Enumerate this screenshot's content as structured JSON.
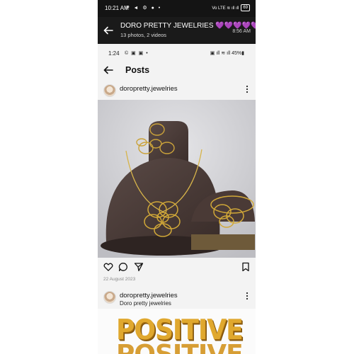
{
  "outer_status": {
    "time": "10:21 AM",
    "left_icons": "P ◄ ⚙ ● •",
    "right_icons": "Vo LTE ≋ ıll ıll",
    "battery": "69"
  },
  "viewer_header": {
    "title": "DORO PRETTY JEWELRIES 💜💜💜💜💜",
    "subtitle": "13 photos, 2 videos",
    "timestamp": "8:56 AM"
  },
  "inner_status": {
    "time": "1:24",
    "left_icons": "© ▣ ▣ •",
    "right_icons": "▣ ıll ≋ ıll 45%▮"
  },
  "posts_header": {
    "title": "Posts"
  },
  "posts": [
    {
      "username": "doropretty.jewelries",
      "date": "22 August 2023",
      "icons": [
        "heart-icon",
        "comment-icon",
        "share-icon",
        "bookmark-icon"
      ]
    },
    {
      "username": "doropretty.jewelries",
      "caption": "Doro pretty jewelries",
      "image_text": "POSITIVE"
    }
  ]
}
